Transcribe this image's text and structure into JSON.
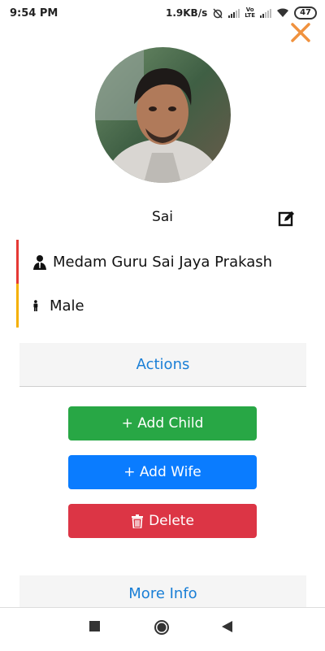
{
  "status_bar": {
    "time": "9:54 PM",
    "network_speed": "1.9KB/s",
    "volte_label_top": "Vo",
    "volte_label_bottom": "LTE",
    "battery_level": "47"
  },
  "profile": {
    "nickname": "Sai",
    "full_name": "Medam Guru Sai Jaya Prakash",
    "gender": "Male"
  },
  "actions": {
    "header": "Actions",
    "add_child_label": "+ Add Child",
    "add_wife_label": "+ Add Wife",
    "delete_label": "Delete"
  },
  "more_info": {
    "header": "More Info"
  },
  "colors": {
    "close_accent": "#f0923e",
    "name_border": "#e53935",
    "gender_border": "#f5b000",
    "section_text": "#1a7fd6",
    "add_child_bg": "#28a745",
    "add_wife_bg": "#0a7cff",
    "delete_bg": "#dc3545"
  },
  "icons": {
    "close": "close-icon",
    "edit": "edit-icon",
    "name": "person-suit-icon",
    "gender": "male-figure-icon",
    "delete": "trash-icon",
    "nav_recents": "square-icon",
    "nav_home": "circle-icon",
    "nav_back": "triangle-back-icon"
  }
}
